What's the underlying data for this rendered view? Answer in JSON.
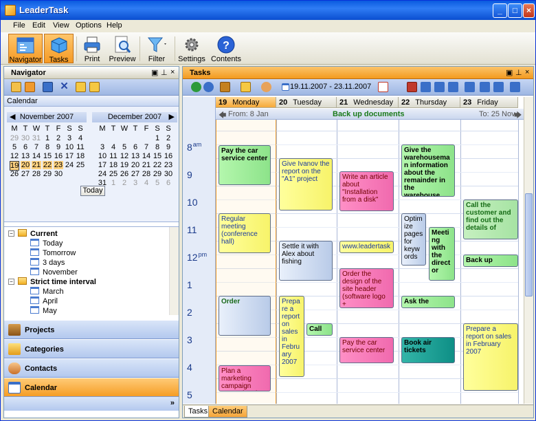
{
  "window": {
    "title": "LeaderTask"
  },
  "menu": [
    "File",
    "Edit",
    "View",
    "Options",
    "Help"
  ],
  "toolbar": {
    "navigator": "Navigator",
    "tasks": "Tasks",
    "print": "Print",
    "preview": "Preview",
    "filter": "Filter",
    "settings": "Settings",
    "contents": "Contents"
  },
  "navigator": {
    "title": "Navigator",
    "calendar_label": "Calendar",
    "left_month": "November 2007",
    "right_month": "December 2007",
    "weekdays": [
      "M",
      "T",
      "W",
      "T",
      "F",
      "S",
      "S"
    ],
    "nov_rows": [
      [
        "29",
        "30",
        "31",
        "1",
        "2",
        "3",
        "4"
      ],
      [
        "5",
        "6",
        "7",
        "8",
        "9",
        "10",
        "11"
      ],
      [
        "12",
        "13",
        "14",
        "15",
        "16",
        "17",
        "18"
      ],
      [
        "19",
        "20",
        "21",
        "22",
        "23",
        "24",
        "25"
      ],
      [
        "26",
        "27",
        "28",
        "29",
        "30",
        "",
        ""
      ]
    ],
    "dec_rows": [
      [
        "",
        "",
        "",
        "",
        "",
        "1",
        "2"
      ],
      [
        "3",
        "4",
        "5",
        "6",
        "7",
        "8",
        "9"
      ],
      [
        "10",
        "11",
        "12",
        "13",
        "14",
        "15",
        "16"
      ],
      [
        "17",
        "18",
        "19",
        "20",
        "21",
        "22",
        "23"
      ],
      [
        "24",
        "25",
        "26",
        "27",
        "28",
        "29",
        "30"
      ],
      [
        "31",
        "1",
        "2",
        "3",
        "4",
        "5",
        "6"
      ]
    ],
    "today_button": "Today",
    "tree": [
      {
        "label": "Current",
        "type": "folder"
      },
      {
        "label": "Today",
        "type": "item"
      },
      {
        "label": "Tomorrow",
        "type": "item"
      },
      {
        "label": "3 days",
        "type": "item"
      },
      {
        "label": "November",
        "type": "item"
      },
      {
        "label": "Strict time interval",
        "type": "folder"
      },
      {
        "label": "March",
        "type": "item"
      },
      {
        "label": "April",
        "type": "item"
      },
      {
        "label": "May",
        "type": "item"
      }
    ],
    "sections": [
      "Projects",
      "Categories",
      "Contacts",
      "Calendar"
    ]
  },
  "tasks": {
    "title": "Tasks",
    "date_range": "19.11.2007 - 23.11.2007",
    "days": [
      {
        "num": "19",
        "name": "Monday"
      },
      {
        "num": "20",
        "name": "Tuesday"
      },
      {
        "num": "21",
        "name": "Wednesday"
      },
      {
        "num": "22",
        "name": "Thursday"
      },
      {
        "num": "23",
        "name": "Friday"
      }
    ],
    "allday": {
      "from": "From: 8 Jan",
      "title": "Back up documents",
      "to": "To: 25 Nov"
    },
    "hours": [
      {
        "h": "8",
        "ap": "am"
      },
      {
        "h": "9",
        "ap": ""
      },
      {
        "h": "10",
        "ap": ""
      },
      {
        "h": "11",
        "ap": ""
      },
      {
        "h": "12",
        "ap": "pm"
      },
      {
        "h": "1",
        "ap": ""
      },
      {
        "h": "2",
        "ap": ""
      },
      {
        "h": "3",
        "ap": ""
      },
      {
        "h": "4",
        "ap": ""
      },
      {
        "h": "5",
        "ap": ""
      }
    ],
    "events": {
      "e1": "Pay the car service center",
      "e2": "Regular meeting (conference hall)",
      "e3": "Order",
      "e4": "Plan a marketing campaign promoting the",
      "e5": "Give Ivanov the report on the \"A1\" project",
      "e6": "Settle it with Alex about fishing",
      "e7": "Prepare a report on sales in February 2007",
      "e8": "Call",
      "e9": "Write an article about \"Installation from a disk\"",
      "e10": "www.leadertask",
      "e11": "Order the design of the site header (software logo +",
      "e12": "Pay the car service center",
      "e13": "Give the warehouseman information about the remainder in the warehouse",
      "e14": "Optimize pages for keywords",
      "e15": "Meeting with the director",
      "e16": "Ask the",
      "e17": "Book air tickets",
      "e18": "Call the customer and find out the details of",
      "e19": "Back up",
      "e20": "Prepare a report on sales in February 2007"
    },
    "bottom_tabs": [
      "Tasks",
      "Calendar"
    ]
  }
}
